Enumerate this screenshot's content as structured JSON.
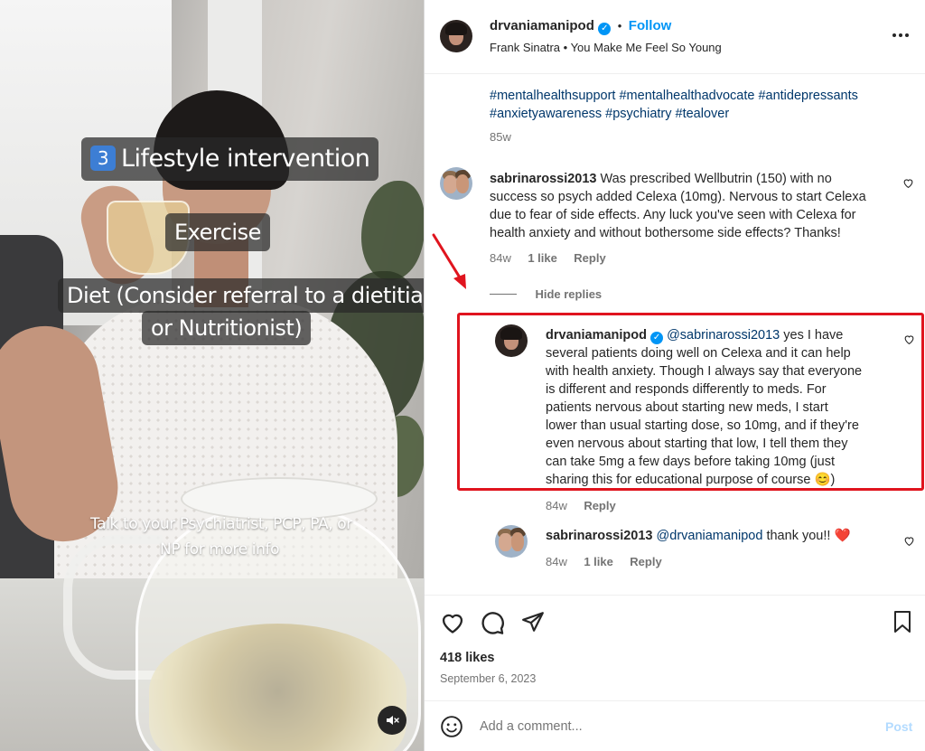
{
  "media": {
    "caption_title_number": "3",
    "caption_title": "Lifestyle intervention",
    "caption_exercise": "Exercise",
    "caption_diet_line1": "Diet (Consider referral to a dietitian",
    "caption_diet_line2": "or Nutritionist)",
    "overlay_line1": "Talk to your Psychiatrist, PCP, PA, or",
    "overlay_line2": "NP for more info",
    "mute_icon": "speaker-muted-icon"
  },
  "header": {
    "username": "drvaniamanipod",
    "follow_label": "Follow",
    "separator": "•",
    "music": "Frank Sinatra • You Make Me Feel So Young",
    "more_icon": "more-horizontal-icon"
  },
  "caption": {
    "hashtags_line1": "#mentalhealthsupport #mentalhealthadvocate #antidepressants",
    "hashtags_line2": "#anxietyawareness #psychiatry #tealover",
    "time": "85w"
  },
  "comments": [
    {
      "username": "sabrinarossi2013",
      "lines": [
        "Was prescribed Wellbutrin (150) with no",
        "success so psych added Celexa (10mg). Nervous to start Celexa",
        "due to fear of side effects. Any luck you've seen with Celexa for",
        "health anxiety and without bothersome side effects? Thanks!"
      ],
      "time": "84w",
      "likes": "1 like",
      "reply": "Reply"
    }
  ],
  "hide_replies": "Hide replies",
  "replies": [
    {
      "username": "drvaniamanipod",
      "mention": "@sabrinarossi2013",
      "lines": [
        "yes I have",
        "several patients doing well on Celexa and it can help",
        "with health anxiety. Though I always say that everyone",
        "is different and responds differently to meds. For",
        "patients nervous about starting new meds, I start",
        "lower than usual starting dose, so 10mg, and if they're",
        "even nervous about starting that low, I tell them they",
        "can take 5mg a few days before taking 10mg (just",
        "sharing this for educational purpose of course"
      ],
      "emoji": "😊",
      "close_paren": ")",
      "time": "84w",
      "reply": "Reply"
    },
    {
      "username": "sabrinarossi2013",
      "mention": "@drvaniamanipod",
      "text": "thank you!!",
      "emoji": "❤️",
      "time": "84w",
      "likes": "1 like",
      "reply": "Reply"
    }
  ],
  "footer": {
    "likes": "418 likes",
    "date": "September 6, 2023",
    "comment_placeholder": "Add a comment...",
    "post_label": "Post"
  },
  "colors": {
    "accent": "#0095f6",
    "highlight": "#e0141e",
    "text": "#262626",
    "muted": "#737373"
  }
}
